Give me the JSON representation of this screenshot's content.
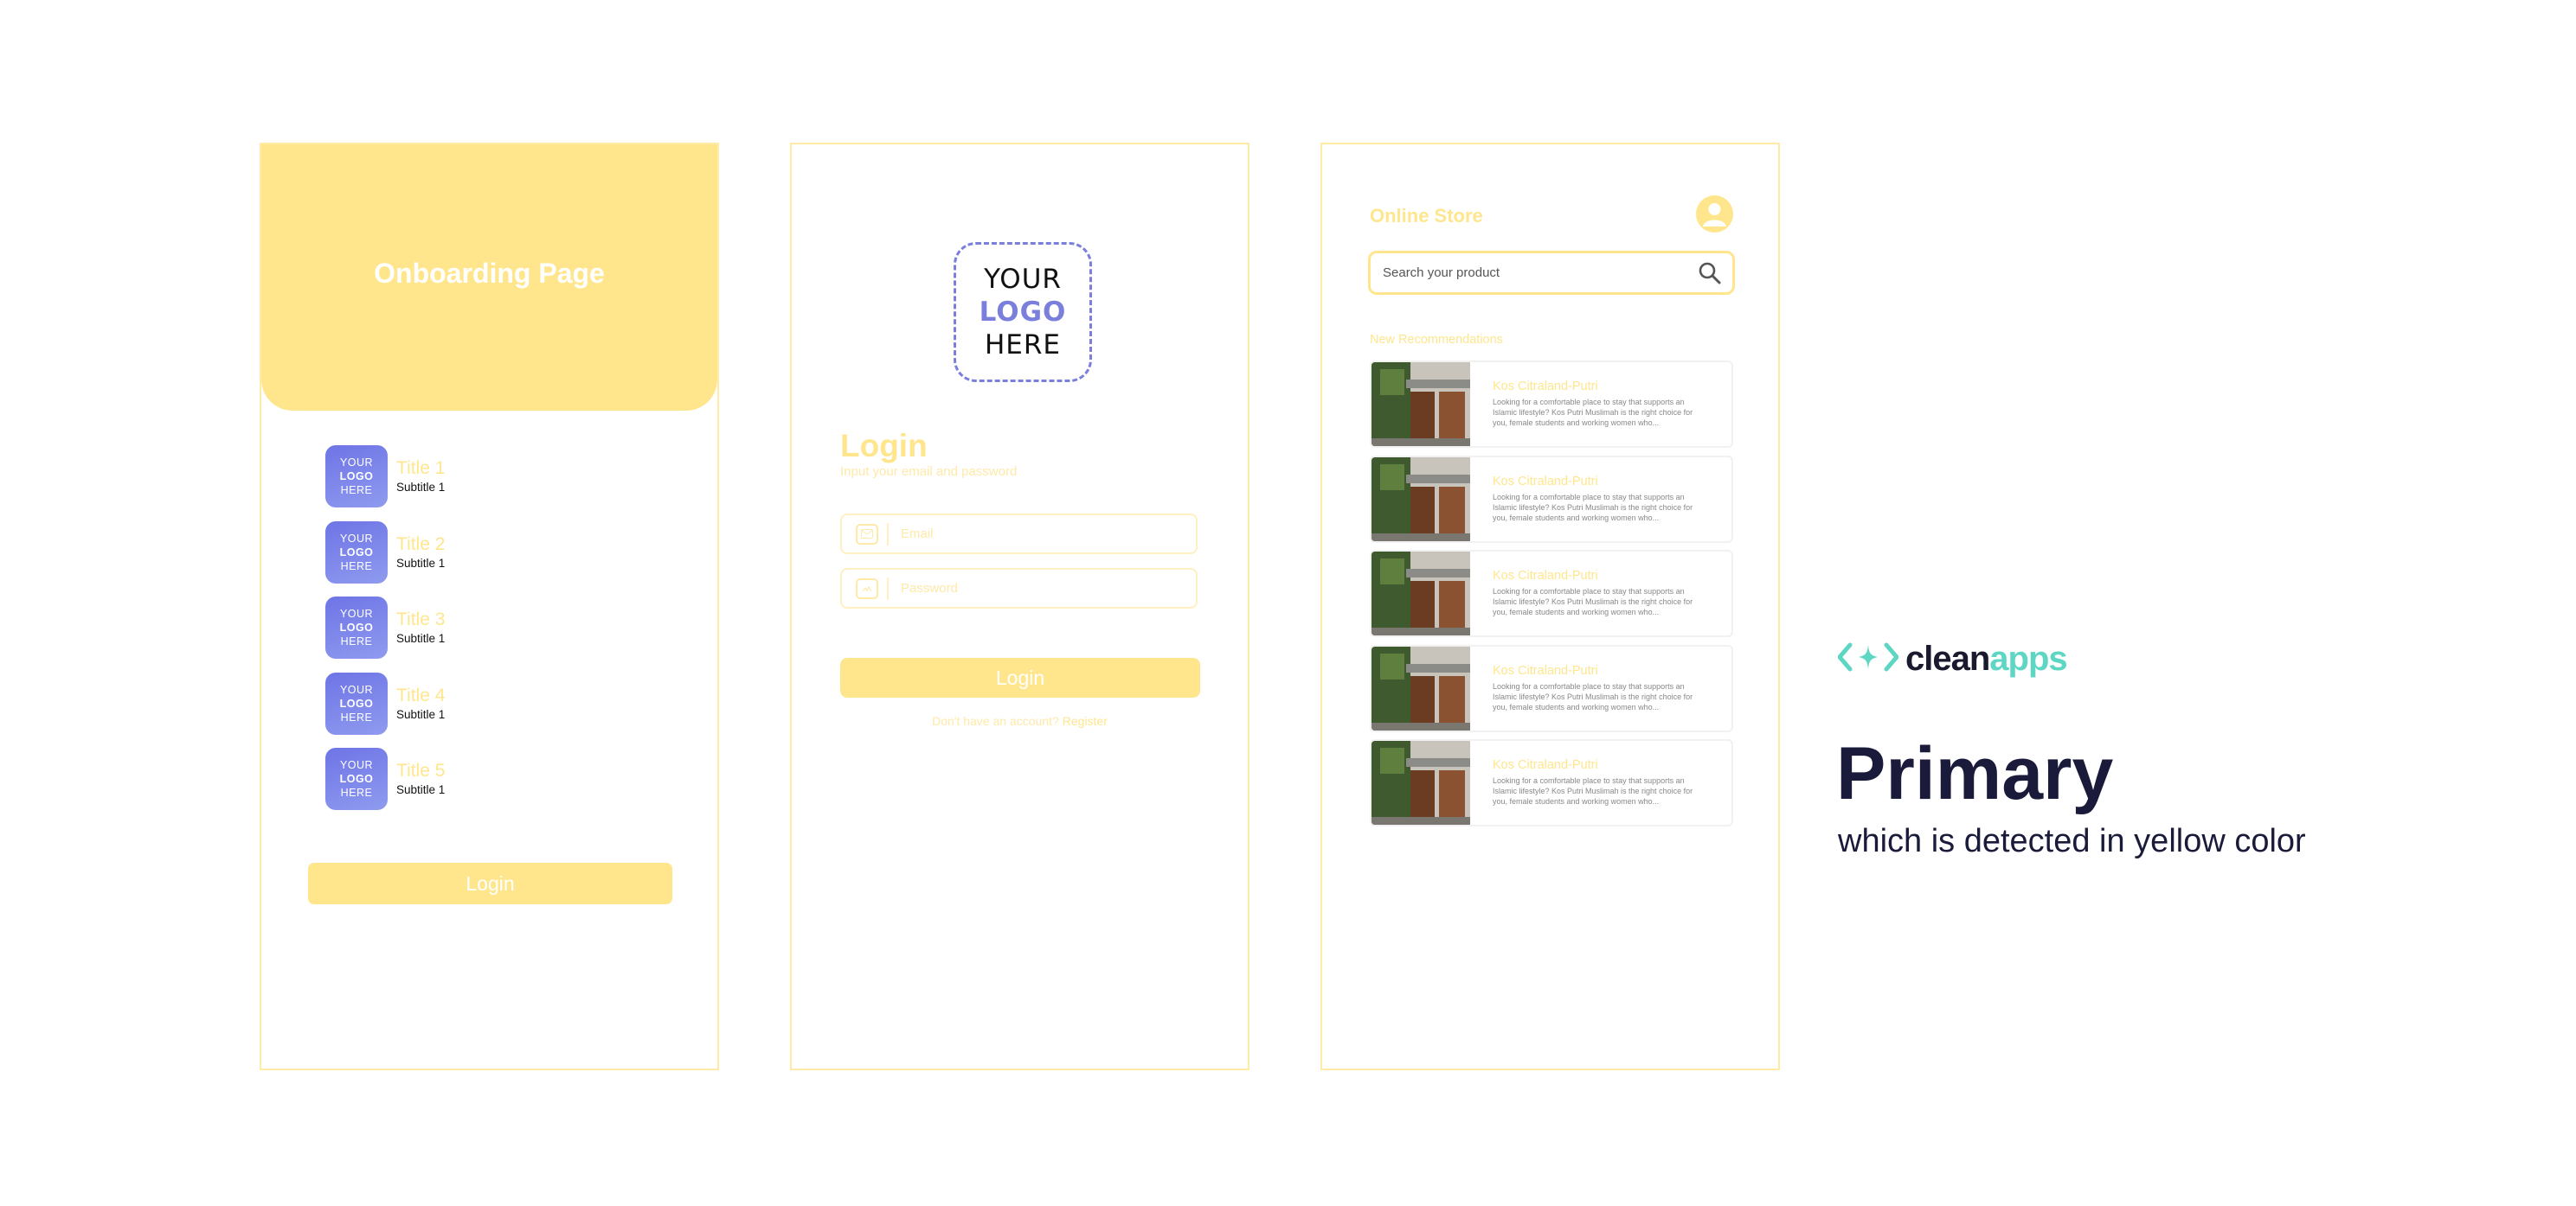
{
  "onboarding": {
    "header_title": "Onboarding Page",
    "items": [
      {
        "logo_top": "YOUR",
        "logo_mid": "LOGO",
        "logo_bottom": "HERE",
        "title": "Title 1",
        "subtitle": "Subtitle 1"
      },
      {
        "logo_top": "YOUR",
        "logo_mid": "LOGO",
        "logo_bottom": "HERE",
        "title": "Title 2",
        "subtitle": "Subtitle 1"
      },
      {
        "logo_top": "YOUR",
        "logo_mid": "LOGO",
        "logo_bottom": "HERE",
        "title": "Title 3",
        "subtitle": "Subtitle 1"
      },
      {
        "logo_top": "YOUR",
        "logo_mid": "LOGO",
        "logo_bottom": "HERE",
        "title": "Title 4",
        "subtitle": "Subtitle 1"
      },
      {
        "logo_top": "YOUR",
        "logo_mid": "LOGO",
        "logo_bottom": "HERE",
        "title": "Title 5",
        "subtitle": "Subtitle 1"
      }
    ],
    "login_label": "Login"
  },
  "login": {
    "logo_top": "YOUR",
    "logo_mid": "LOGO",
    "logo_bottom": "HERE",
    "title": "Login",
    "subtitle": "Input your email and password",
    "email_placeholder": "Email",
    "password_placeholder": "Password",
    "button_label": "Login",
    "footer_text": "Don't have an account?",
    "register_label": "Register"
  },
  "store": {
    "title": "Online Store",
    "search_placeholder": "Search your product",
    "section_title": "New Recommendations",
    "cards": [
      {
        "title": "Kos Citraland-Putri",
        "desc": "Looking for a comfortable place to stay that supports an Islamic lifestyle? Kos Putri Muslimah is the right choice for you, female students and working women who..."
      },
      {
        "title": "Kos Citraland-Putri",
        "desc": "Looking for a comfortable place to stay that supports an Islamic lifestyle? Kos Putri Muslimah is the right choice for you, female students and working women who..."
      },
      {
        "title": "Kos Citraland-Putri",
        "desc": "Looking for a comfortable place to stay that supports an Islamic lifestyle? Kos Putri Muslimah is the right choice for you, female students and working women who..."
      },
      {
        "title": "Kos Citraland-Putri",
        "desc": "Looking for a comfortable place to stay that supports an Islamic lifestyle? Kos Putri Muslimah is the right choice for you, female students and working women who..."
      },
      {
        "title": "Kos Citraland-Putri",
        "desc": "Looking for a comfortable place to stay that supports an Islamic lifestyle? Kos Putri Muslimah is the right choice for you, female students and working women who..."
      }
    ]
  },
  "brand": {
    "word_dark": "clean",
    "word_accent": "apps",
    "heading": "Primary",
    "subheading": "which is detected in yellow color"
  },
  "colors": {
    "primary": "#FFE68D",
    "logo_accent": "#7B7FDC",
    "brand_accent": "#5ED6C4",
    "heading_text": "#1A1A3A"
  },
  "icons": [
    "email-icon",
    "lock-icon",
    "search-icon",
    "user-avatar-icon",
    "cleanapps-logo-icon"
  ]
}
